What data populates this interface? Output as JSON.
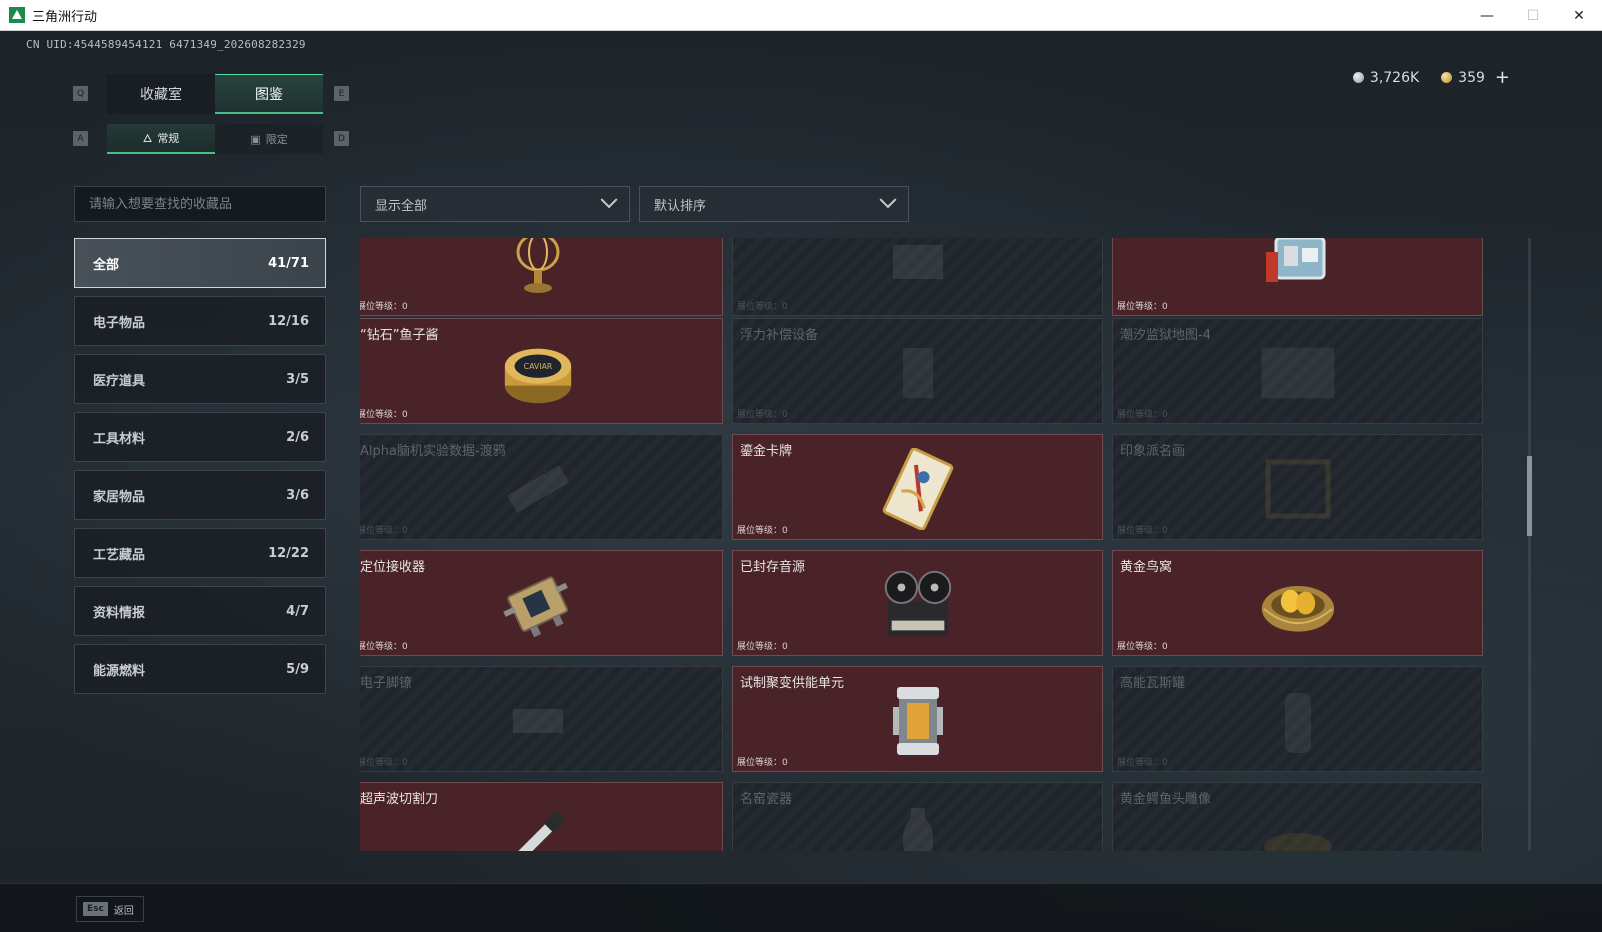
{
  "window": {
    "title": "三角洲行动",
    "minimize": "—",
    "maximize": "☐",
    "close": "✕"
  },
  "header": {
    "uid": "CN UID:4544589454121 6471349_202608282329",
    "silver_amount": "3,726K",
    "gold_amount": "359",
    "plus": "+"
  },
  "keys": {
    "q": "Q",
    "e": "E",
    "a": "A",
    "d": "D"
  },
  "tabs": [
    {
      "label": "收藏室",
      "active": false
    },
    {
      "label": "图鉴",
      "active": true
    }
  ],
  "subtabs": [
    {
      "label": "常规",
      "icon": "🜂",
      "active": true
    },
    {
      "label": "限定",
      "icon": "▣",
      "active": false
    }
  ],
  "search": {
    "placeholder": "请输入想要查找的收藏品"
  },
  "filters": {
    "show": "显示全部",
    "sort": "默认排序"
  },
  "categories": [
    {
      "label": "全部",
      "count": "41/71",
      "active": true
    },
    {
      "label": "电子物品",
      "count": "12/16"
    },
    {
      "label": "医疗道具",
      "count": "3/5"
    },
    {
      "label": "工具材料",
      "count": "2/6"
    },
    {
      "label": "家居物品",
      "count": "3/6"
    },
    {
      "label": "工艺藏品",
      "count": "12/22"
    },
    {
      "label": "资料情报",
      "count": "4/7"
    },
    {
      "label": "能源燃料",
      "count": "5/9"
    }
  ],
  "level_label": "展位等级：0",
  "cards": [
    {
      "name": "",
      "owned": true,
      "icon": "armillary-sphere-icon"
    },
    {
      "name": "",
      "owned": false,
      "icon": "chessboard-icon"
    },
    {
      "name": "",
      "owned": true,
      "icon": "machine-icon"
    },
    {
      "name": "“钻石”鱼子酱",
      "owned": true,
      "icon": "caviar-tin-icon",
      "tin_label": "CAVIAR"
    },
    {
      "name": "浮力补偿设备",
      "owned": false,
      "icon": "buoyancy-device-icon"
    },
    {
      "name": "潮汐监狱地图-4",
      "owned": false,
      "icon": "map-icon"
    },
    {
      "name": "Alpha脑机实验数据-渡鸦",
      "owned": false,
      "icon": "data-drive-icon"
    },
    {
      "name": "鎏金卡牌",
      "owned": true,
      "icon": "gilded-card-icon"
    },
    {
      "name": "印象派名画",
      "owned": false,
      "icon": "painting-icon"
    },
    {
      "name": "定位接收器",
      "owned": true,
      "icon": "receiver-icon"
    },
    {
      "name": "已封存音源",
      "owned": true,
      "icon": "reel-recorder-icon"
    },
    {
      "name": "黄金鸟窝",
      "owned": true,
      "icon": "golden-nest-icon"
    },
    {
      "name": "电子脚镣",
      "owned": false,
      "icon": "ankle-monitor-icon"
    },
    {
      "name": "试制聚变供能单元",
      "owned": true,
      "icon": "fusion-cell-icon"
    },
    {
      "name": "高能瓦斯罐",
      "owned": false,
      "icon": "gas-tank-icon"
    },
    {
      "name": "超声波切割刀",
      "owned": true,
      "icon": "cutter-icon"
    },
    {
      "name": "名窑瓷器",
      "owned": false,
      "icon": "vase-icon"
    },
    {
      "name": "黄金鳄鱼头雕像",
      "owned": false,
      "icon": "croc-statue-icon"
    }
  ],
  "bottom": {
    "esc_key": "Esc",
    "esc_label": "返回"
  }
}
